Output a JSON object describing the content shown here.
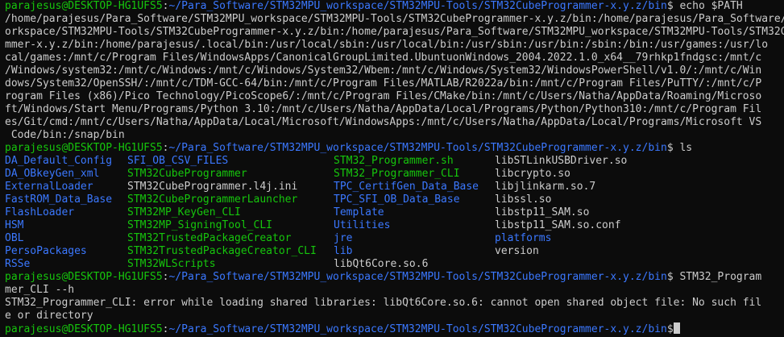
{
  "prompt": {
    "user": "parajesus@DESKTOP-HG1UFS5",
    "sep": ":",
    "path": "~/Para_Software/STM32MPU_workspace/STM32MPU-Tools/STM32CubeProgrammer-x.y.z/bin",
    "symbol": "$"
  },
  "cmd1": " echo $PATH",
  "path_output": [
    "/home/parajesus/Para_Software/STM32MPU_workspace/STM32MPU-Tools/STM32CubeProgrammer-x.y.z/bin:/home/parajesus/Para_Software/STM32MPU_w",
    "orkspace/STM32MPU-Tools/STM32CubeProgrammer-x.y.z/bin:/home/parajesus/Para_Software/STM32MPU_workspace/STM32MPU-Tools/STM32CubeProgra",
    "mmer-x.y.z/bin:/home/parajesus/.local/bin:/usr/local/sbin:/usr/local/bin:/usr/sbin:/usr/bin:/sbin:/bin:/usr/games:/usr/lo",
    "cal/games:/mnt/c/Program Files/WindowsApps/CanonicalGroupLimited.UbuntuonWindows_2004.2022.1.0_x64__79rhkp1fndgsc:/mnt/c",
    "/Windows/system32:/mnt/c/Windows:/mnt/c/Windows/System32/Wbem:/mnt/c/Windows/System32/WindowsPowerShell/v1.0/:/mnt/c/Win",
    "dows/System32/OpenSSH/:/mnt/c/TDM-GCC-64/bin:/mnt/c/Program Files/MATLAB/R2022a/bin:/mnt/c/Program Files/PuTTY/:/mnt/c/P",
    "rogram Files (x86)/Pico Technology/PicoScope6/:/mnt/c/Program Files/CMake/bin:/mnt/c/Users/Natha/AppData/Roaming/Microso",
    "ft/Windows/Start Menu/Programs/Python 3.10:/mnt/c/Users/Natha/AppData/Local/Programs/Python/Python310:/mnt/c/Program Fil",
    "es/Git/cmd:/mnt/c/Users/Natha/AppData/Local/Microsoft/WindowsApps:/mnt/c/Users/Natha/AppData/Local/Programs/Microsoft VS",
    " Code/bin:/snap/bin"
  ],
  "cmd2": " ls",
  "ls_rows": [
    [
      {
        "t": "DA_Default_Config",
        "c": "d"
      },
      {
        "t": "SFI_OB_CSV_FILES",
        "c": "d"
      },
      {
        "t": "STM32_Programmer.sh",
        "c": "g"
      },
      {
        "t": "libSTLinkUSBDriver.so",
        "c": "w"
      }
    ],
    [
      {
        "t": "DA_OBkeyGen_xml",
        "c": "d"
      },
      {
        "t": "STM32CubeProgrammer",
        "c": "g"
      },
      {
        "t": "STM32_Programmer_CLI",
        "c": "g"
      },
      {
        "t": "libcrypto.so",
        "c": "w"
      }
    ],
    [
      {
        "t": "ExternalLoader",
        "c": "d"
      },
      {
        "t": "STM32CubeProgrammer.l4j.ini",
        "c": "w"
      },
      {
        "t": "TPC_CertifGen_Data_Base",
        "c": "d"
      },
      {
        "t": "libjlinkarm.so.7",
        "c": "w"
      }
    ],
    [
      {
        "t": "FastROM_Data_Base",
        "c": "d"
      },
      {
        "t": "STM32CubeProgrammerLauncher",
        "c": "g"
      },
      {
        "t": "TPC_SFI_OB_Data_Base",
        "c": "d"
      },
      {
        "t": "libssl.so",
        "c": "w"
      }
    ],
    [
      {
        "t": "FlashLoader",
        "c": "d"
      },
      {
        "t": "STM32MP_KeyGen_CLI",
        "c": "g"
      },
      {
        "t": "Template",
        "c": "d"
      },
      {
        "t": "libstp11_SAM.so",
        "c": "w"
      }
    ],
    [
      {
        "t": "HSM",
        "c": "d"
      },
      {
        "t": "STM32MP_SigningTool_CLI",
        "c": "g"
      },
      {
        "t": "Utilities",
        "c": "d"
      },
      {
        "t": "libstp11_SAM.so.conf",
        "c": "w"
      }
    ],
    [
      {
        "t": "OBL",
        "c": "d"
      },
      {
        "t": "STM32TrustedPackageCreator",
        "c": "g"
      },
      {
        "t": "jre",
        "c": "d"
      },
      {
        "t": "platforms",
        "c": "d"
      }
    ],
    [
      {
        "t": "PersoPackages",
        "c": "d"
      },
      {
        "t": "STM32TrustedPackageCreator_CLI",
        "c": "g"
      },
      {
        "t": "lib",
        "c": "d"
      },
      {
        "t": "version",
        "c": "w"
      }
    ],
    [
      {
        "t": "RSSe",
        "c": "d"
      },
      {
        "t": "STM32WLScripts",
        "c": "g"
      },
      {
        "t": "libQt6Core.so.6",
        "c": "w"
      },
      {
        "t": "",
        "c": "w"
      }
    ]
  ],
  "cmd3": " STM32_Program",
  "cmd3_cont": "mer_CLI --h",
  "error_lines": [
    "STM32_Programmer_CLI: error while loading shared libraries: libQt6Core.so.6: cannot open shared object file: No such fil",
    "e or directory"
  ]
}
